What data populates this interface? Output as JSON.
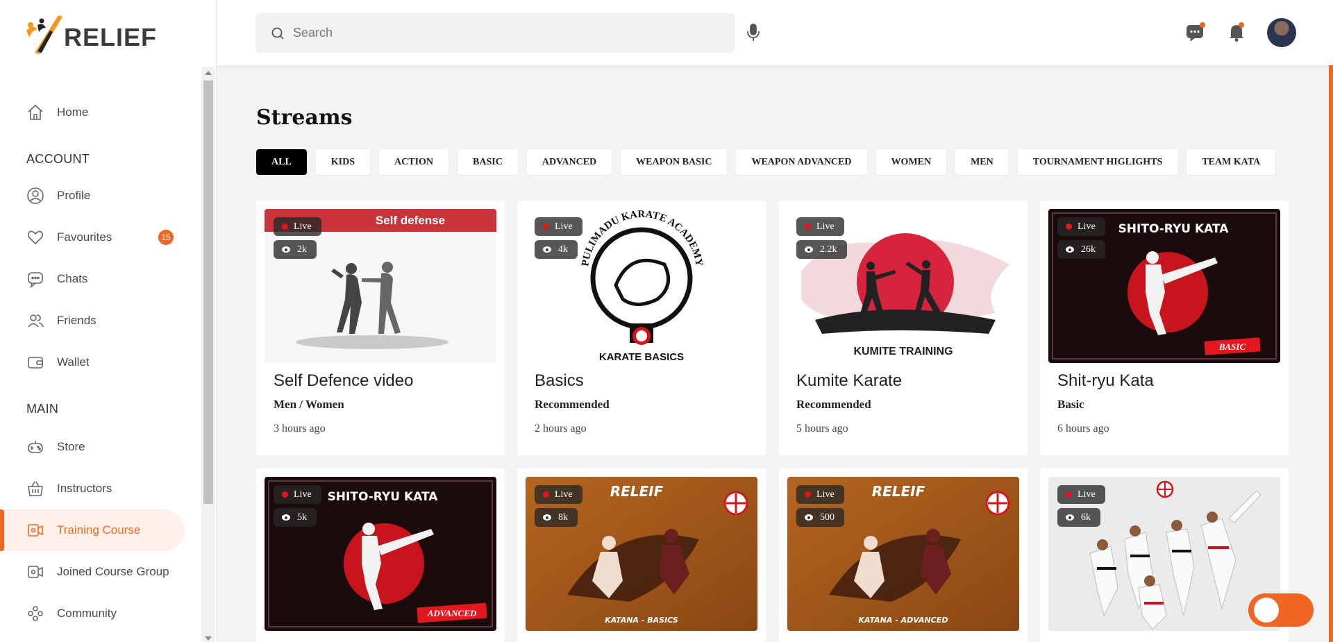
{
  "app": {
    "name": "RELIEF"
  },
  "search": {
    "placeholder": "Search"
  },
  "sidebar": {
    "home": "Home",
    "account_heading": "ACCOUNT",
    "profile": "Profile",
    "favourites": "Favourites",
    "favourites_count": "15",
    "chats": "Chats",
    "friends": "Friends",
    "wallet": "Wallet",
    "main_heading": "MAIN",
    "store": "Store",
    "instructors": "Instructors",
    "training_course": "Training Course",
    "joined_course_group": "Joined Course Group",
    "community": "Community"
  },
  "page": {
    "title": "Streams"
  },
  "filters": [
    "ALL",
    "KIDS",
    "ACTION",
    "BASIC",
    "ADVANCED",
    "WEAPON BASIC",
    "WEAPON ADVANCED",
    "WOMEN",
    "MEN",
    "TOURNAMENT HIGLIGHTS",
    "TEAM KATA"
  ],
  "active_filter": "ALL",
  "live_label": "Live",
  "streams": [
    {
      "title": "Self Defence video",
      "category": "Men / Women",
      "time": "3 hours ago",
      "views": "2k",
      "thumb_text": "Self defense"
    },
    {
      "title": "Basics",
      "category": "Recommended",
      "time": "2 hours ago",
      "views": "4k",
      "thumb_text": "PULIMADU KARATE ACADEMY",
      "thumb_caption": "KARATE BASICS"
    },
    {
      "title": "Kumite Karate",
      "category": "Recommended",
      "time": "5 hours ago",
      "views": "2.2k",
      "thumb_caption": "KUMITE TRAINING"
    },
    {
      "title": "Shit-ryu Kata",
      "category": "Basic",
      "time": "6 hours ago",
      "views": "26k",
      "thumb_text": "SHITO-RYU KATA",
      "thumb_tag": "BASIC"
    },
    {
      "views": "5k",
      "thumb_text": "SHITO-RYU KATA",
      "thumb_tag": "ADVANCED"
    },
    {
      "views": "8k",
      "thumb_text": "RELEIF",
      "thumb_caption": "KATANA - BASICS"
    },
    {
      "views": "500",
      "thumb_text": "RELEIF",
      "thumb_caption": "KATANA - ADVANCED"
    },
    {
      "views": "6k"
    }
  ],
  "colors": {
    "accent": "#f26522",
    "live_dot": "#e0161b"
  }
}
